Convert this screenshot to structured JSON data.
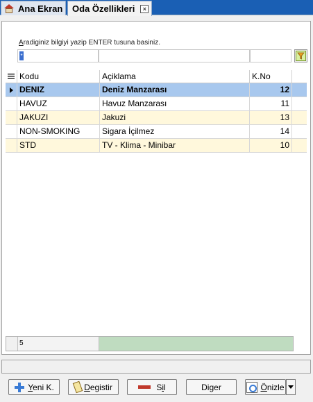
{
  "tabs": [
    {
      "label": "Ana Ekran",
      "icon": "home-icon"
    },
    {
      "label": "Oda Özellikleri",
      "active": true
    }
  ],
  "search": {
    "hint_first": "A",
    "hint_rest": "radiginiz bilgiyi yazip ENTER tusuna basiniz.",
    "first_cell_value": "*"
  },
  "grid": {
    "columns": [
      "Kodu",
      "Açiklama",
      "K.No"
    ],
    "rows": [
      {
        "code": "DENIZ",
        "desc": "Deniz Manzarası",
        "no": "12",
        "selected": true
      },
      {
        "code": "HAVUZ",
        "desc": "Havuz Manzarası",
        "no": "11"
      },
      {
        "code": "JAKUZI",
        "desc": "Jakuzi",
        "no": "13"
      },
      {
        "code": "NON-SMOKING",
        "desc": "Sigara İçilmez",
        "no": "14"
      },
      {
        "code": "STD",
        "desc": "TV - Klima - Minibar",
        "no": "10"
      }
    ],
    "footer_count": "5"
  },
  "buttons": {
    "new": {
      "u": "Y",
      "rest": "eni K."
    },
    "edit": {
      "u": "D",
      "rest": "egistir"
    },
    "delete": {
      "pre": "S",
      "u": "i",
      "rest": "l"
    },
    "other": {
      "pre": "Di",
      "u": "g",
      "rest": "er"
    },
    "preview": {
      "u": "Ö",
      "rest": "nizle"
    }
  },
  "colors": {
    "selected_row": "#a8c8ee",
    "alt_row": "#fff8dc",
    "footer_fill": "#bfdcc0",
    "tabstrip": "#1a5fb4"
  }
}
